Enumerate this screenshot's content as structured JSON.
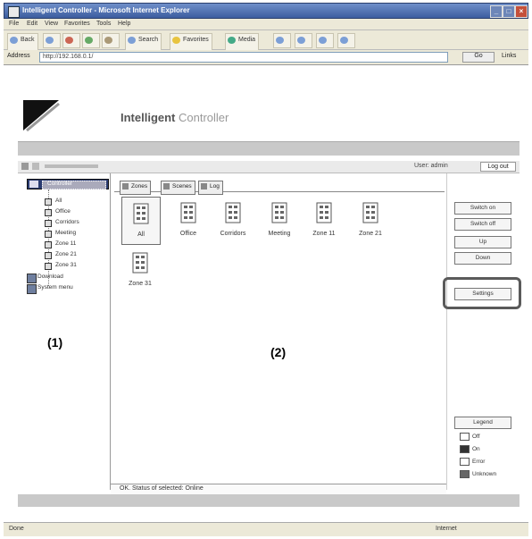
{
  "window": {
    "title": "Intelligent Controller - Microsoft Internet Explorer",
    "buttons": [
      "_",
      "□",
      "×"
    ]
  },
  "menubar": [
    "File",
    "Edit",
    "View",
    "Favorites",
    "Tools",
    "Help"
  ],
  "toolbar": [
    "Back",
    "Search",
    "Favorites",
    "Media"
  ],
  "addressbar": {
    "label": "Address",
    "url": "http://192.168.0.1/",
    "go_label": "Go",
    "links_label": "Links"
  },
  "header": {
    "brand_bold": "Intelligent",
    "brand_light": " Controller"
  },
  "navrow": {
    "user_info": "User: admin",
    "logout_label": "Log out"
  },
  "tree": {
    "root_label": "Controller",
    "items": [
      "All",
      "Office",
      "Corridors",
      "Meeting",
      "Zone 11",
      "Zone 21",
      "Zone 31"
    ],
    "extra_items": [
      "Download",
      "System menu"
    ]
  },
  "tabs": [
    "Zones",
    "Scenes",
    "Log"
  ],
  "zones": [
    "All",
    "Office",
    "Corridors",
    "Meeting",
    "Zone 11",
    "Zone 21",
    "Zone 31"
  ],
  "status_text": "OK. Status of selected: Online",
  "right_buttons": [
    "Switch on",
    "Switch off",
    "Up",
    "Down",
    "Settings"
  ],
  "legend": {
    "title": "Legend",
    "items": [
      {
        "label": "Off",
        "color": "#ffffff"
      },
      {
        "label": "On",
        "color": "#333333"
      },
      {
        "label": "Error",
        "color": "#ffffff"
      },
      {
        "label": "Unknown",
        "color": "#666666"
      }
    ]
  },
  "markers": {
    "left": "(1)",
    "main": "(2)"
  },
  "browser_status": {
    "left": "Done",
    "right": "Internet"
  },
  "colors": {
    "title_bar": "#3c5d9f",
    "tree_selected": "#2a3b70",
    "callout": "#5a5a5a"
  }
}
